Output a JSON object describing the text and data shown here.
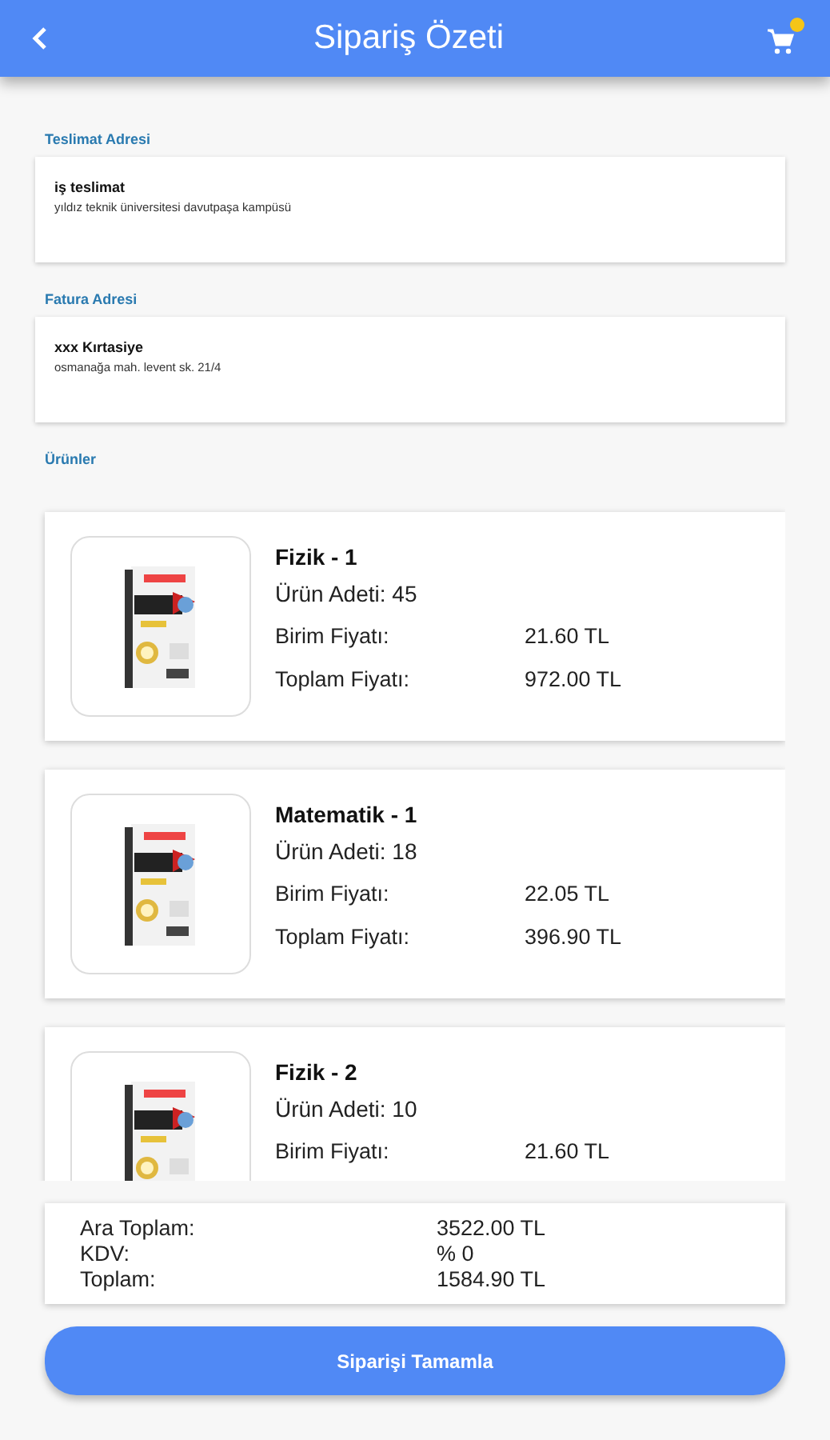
{
  "header": {
    "title": "Sipariş Özeti"
  },
  "delivery": {
    "label": "Teslimat Adresi",
    "name": "iş teslimat",
    "address": "yıldız teknik üniversitesi davutpaşa kampüsü"
  },
  "billing": {
    "label": "Fatura Adresi",
    "name": "xxx Kırtasiye",
    "address": "osmanağa mah. levent sk. 21/4"
  },
  "products_label": "Ürünler",
  "products": [
    {
      "title": "Fizik - 1",
      "quantity": "Ürün Adeti: 45",
      "unit_label": "Birim Fiyatı:",
      "unit_price": "21.60 TL",
      "total_label": "Toplam Fiyatı:",
      "total_price": "972.00 TL"
    },
    {
      "title": "Matematik - 1",
      "quantity": "Ürün Adeti: 18",
      "unit_label": "Birim Fiyatı:",
      "unit_price": "22.05 TL",
      "total_label": "Toplam Fiyatı:",
      "total_price": "396.90 TL"
    },
    {
      "title": "Fizik - 2",
      "quantity": "Ürün Adeti: 10",
      "unit_label": "Birim Fiyatı:",
      "unit_price": "21.60 TL"
    }
  ],
  "summary": [
    {
      "label": "Ara Toplam:",
      "value": "3522.00 TL"
    },
    {
      "label": "KDV:",
      "value": "% 0"
    },
    {
      "label": "Toplam:",
      "value": "1584.90 TL"
    }
  ],
  "button": "Siparişi Tamamla"
}
